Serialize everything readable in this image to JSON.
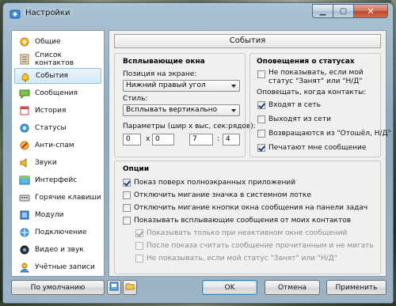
{
  "window": {
    "title": "Настройки"
  },
  "sidebar": {
    "items": [
      {
        "label": "Общие",
        "icon": "general-icon"
      },
      {
        "label": "Список контактов",
        "icon": "contact-list-icon"
      },
      {
        "label": "События",
        "icon": "events-icon",
        "active": true
      },
      {
        "label": "Сообщения",
        "icon": "messages-icon"
      },
      {
        "label": "История",
        "icon": "history-icon"
      },
      {
        "label": "Статусы",
        "icon": "statuses-icon"
      },
      {
        "label": "Анти-спам",
        "icon": "antispam-icon"
      },
      {
        "label": "Звуки",
        "icon": "sounds-icon"
      },
      {
        "label": "Интерфейс",
        "icon": "interface-icon"
      },
      {
        "label": "Горячие клавиши",
        "icon": "hotkeys-icon"
      },
      {
        "label": "Модули",
        "icon": "modules-icon"
      },
      {
        "label": "Подключение",
        "icon": "connection-icon"
      },
      {
        "label": "Видео и звук",
        "icon": "video-audio-icon"
      },
      {
        "label": "Учётные записи",
        "icon": "accounts-icon"
      }
    ]
  },
  "panel": {
    "title": "События"
  },
  "popups": {
    "title": "Всплывающие окна",
    "position_label": "Позиция на экране:",
    "position_value": "Нижний правый угол",
    "style_label": "Стиль:",
    "style_value": "Всплывать вертикально",
    "params_label": "Параметры (шир х выс, сек:рядов):",
    "width": "0",
    "x_sep": "x",
    "height": "0",
    "seconds": "7",
    "colon": ":",
    "rows": "4"
  },
  "status_alerts": {
    "title": "Оповещения о статусах",
    "dont_show": {
      "label": "Не показывать, если мой статус \"Занят\" или \"Н/Д\"",
      "checked": false
    },
    "notify_when_label": "Оповещать, когда контакты:",
    "items": [
      {
        "label": "Входят в сеть",
        "checked": true
      },
      {
        "label": "Выходят из сети",
        "checked": false
      },
      {
        "label": "Возвращаются из \"Отошёл, Н/Д\"",
        "checked": false
      },
      {
        "label": "Печатают мне сообщение",
        "checked": true
      }
    ]
  },
  "options": {
    "title": "Опции",
    "items": [
      {
        "label": "Показ поверх полноэкранных приложений",
        "checked": true,
        "disabled": false
      },
      {
        "label": "Отключить мигание значка в системном лотке",
        "checked": false,
        "disabled": false
      },
      {
        "label": "Отключить мигание кнопки окна сообщения на панели задач",
        "checked": false,
        "disabled": false
      },
      {
        "label": "Показывать всплывающие сообщения от моих контактов",
        "checked": false,
        "disabled": false
      },
      {
        "label": "Показывать только при неактивном окне сообщений",
        "checked": true,
        "disabled": true
      },
      {
        "label": "После показа считать сообщение прочитанным и не мигать",
        "checked": false,
        "disabled": true
      },
      {
        "label": "Не показывать, если мой статус \"Занят\" или \"Н/Д\"",
        "checked": false,
        "disabled": true
      }
    ]
  },
  "footer": {
    "defaults_label": "По умолчанию",
    "ok_label": "OK",
    "cancel_label": "Отмена",
    "apply_label": "Применить"
  }
}
